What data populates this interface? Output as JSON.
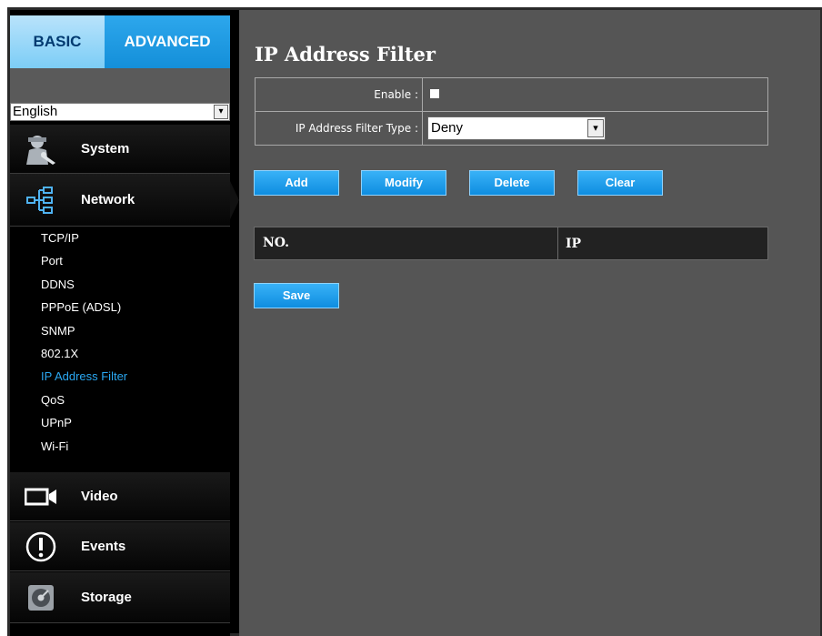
{
  "sidebar": {
    "tabs": {
      "basic": "BASIC",
      "advanced": "ADVANCED"
    },
    "language": {
      "selected": "English"
    },
    "menu": {
      "system": "System",
      "network": "Network",
      "video": "Video",
      "events": "Events",
      "storage": "Storage"
    },
    "network_sub": [
      {
        "label": "TCP/IP"
      },
      {
        "label": "Port"
      },
      {
        "label": "DDNS"
      },
      {
        "label": "PPPoE (ADSL)"
      },
      {
        "label": "SNMP"
      },
      {
        "label": "802.1X"
      },
      {
        "label": "IP Address Filter",
        "active": true
      },
      {
        "label": "QoS"
      },
      {
        "label": "UPnP"
      },
      {
        "label": "Wi-Fi"
      }
    ]
  },
  "main": {
    "title": "IP Address Filter",
    "form": {
      "enable_label": "Enable :",
      "enable_checked": false,
      "type_label": "IP Address Filter Type :",
      "type_value": "Deny"
    },
    "buttons": {
      "add": "Add",
      "modify": "Modify",
      "delete": "Delete",
      "clear": "Clear",
      "save": "Save"
    },
    "table": {
      "columns": [
        "NO.",
        "IP"
      ]
    }
  },
  "colors": {
    "accent": "#148fd9",
    "active_link": "#2aa8f2",
    "content_bg": "#555555"
  }
}
